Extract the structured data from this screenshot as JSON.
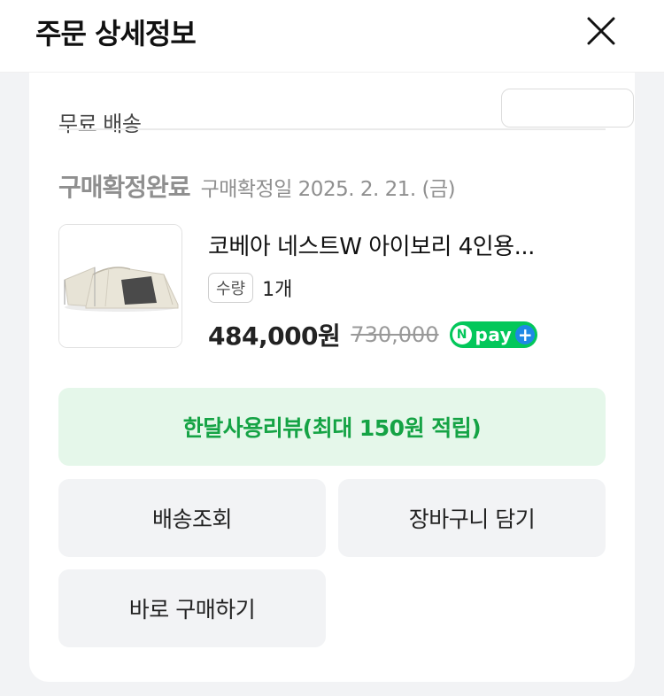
{
  "header": {
    "title": "주문 상세정보",
    "close_icon": "close-icon"
  },
  "shipping_partial": {
    "label": "무료 배송"
  },
  "order": {
    "status_label": "구매확정완료",
    "status_date": "구매확정일 2025. 2. 21. (금)",
    "product_name": "코베아 네스트W 아이보리 4인용...",
    "qty_label": "수량",
    "qty_value": "1개",
    "price": "484,000원",
    "original_price": "730,000",
    "npay": {
      "n": "N",
      "text": "pay",
      "plus": "+"
    }
  },
  "buttons": {
    "review": "한달사용리뷰(최대 150원 적립)",
    "delivery": "배송조회",
    "cart": "장바구니 담기",
    "buy_now": "바로 구매하기"
  },
  "colors": {
    "review_bg": "#e5f7ea",
    "review_text": "#15a345",
    "npay_green": "#03c75a",
    "npay_plus_blue": "#1e88e5",
    "gray_button": "#f2f3f5"
  }
}
